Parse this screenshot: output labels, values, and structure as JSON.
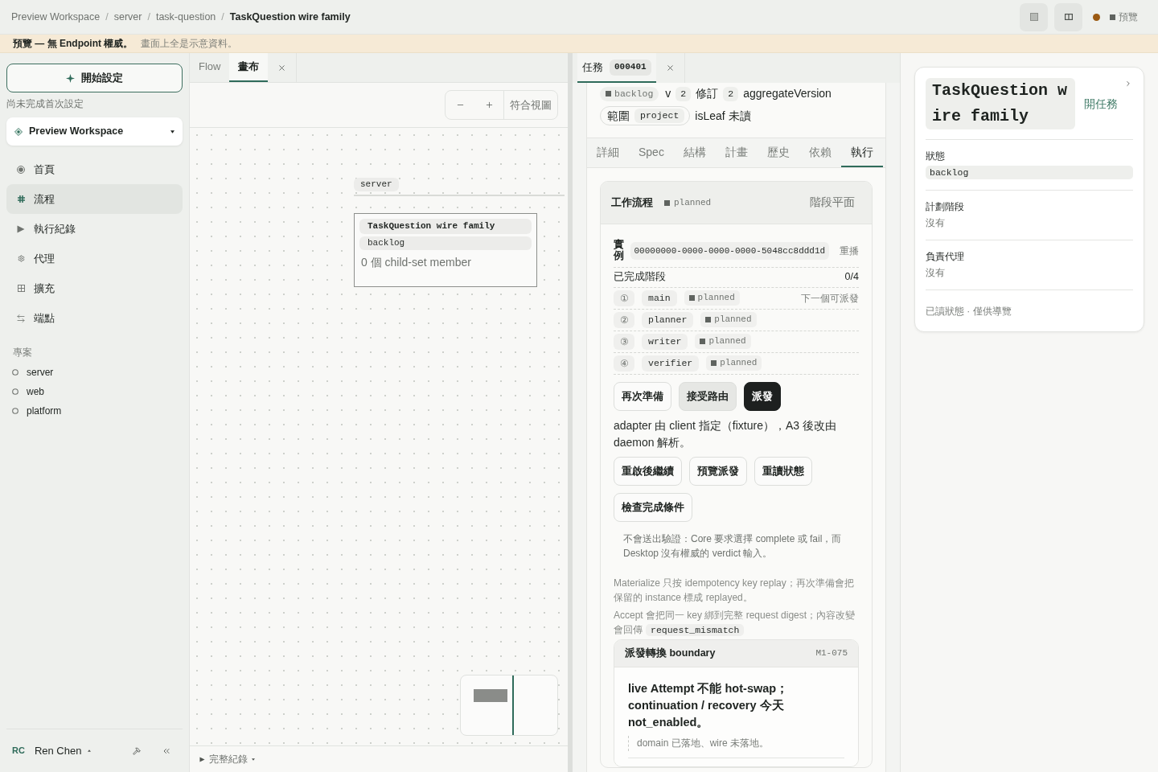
{
  "breadcrumb": {
    "separator": "/",
    "items": [
      {
        "label": "Preview Workspace",
        "current": false
      },
      {
        "label": "server",
        "current": false
      },
      {
        "label": "task-question",
        "current": false
      },
      {
        "label": "TaskQuestion wire family",
        "current": true
      }
    ]
  },
  "topbar": {
    "status": {
      "color": "#9b5a12"
    },
    "mode": "預覽"
  },
  "banner": {
    "title": "預覽 — 無 Endpoint 權威。",
    "text": "畫面上全是示意資料。"
  },
  "sidebar": {
    "setup_button": "開始設定",
    "setup_hint": "尚未完成首次設定",
    "workspace": "Preview Workspace",
    "nav": [
      {
        "label": "首頁",
        "selected": false
      },
      {
        "label": "流程",
        "selected": true
      },
      {
        "label": "執行紀錄",
        "selected": false
      },
      {
        "label": "代理",
        "selected": false
      },
      {
        "label": "擴充",
        "selected": false
      },
      {
        "label": "端點",
        "selected": false
      }
    ],
    "projects": {
      "title": "專案",
      "items": [
        {
          "label": "server"
        },
        {
          "label": "web"
        },
        {
          "label": "platform"
        }
      ]
    },
    "user": {
      "initials": "RC",
      "name": "Ren Chen"
    }
  },
  "canvas_panel": {
    "tabs": [
      {
        "label": "Flow",
        "selected": false
      },
      {
        "label": "畫布",
        "selected": true
      }
    ],
    "fit_button": "符合視圖",
    "group": {
      "label": "server"
    },
    "node": {
      "title": "TaskQuestion wire family",
      "status": "backlog",
      "members": "0 個 child-set member"
    },
    "footer": {
      "label": "完整紀錄"
    }
  },
  "task_panel": {
    "tab": {
      "label": "任務",
      "id": "000401",
      "selected": true
    },
    "chips": {
      "status": "backlog",
      "version": {
        "label": "v",
        "value": "2"
      },
      "revision": {
        "label": "修訂",
        "value": "2"
      },
      "aggregate": "aggregateVersion",
      "scope": {
        "label": "範圍",
        "value": "project"
      },
      "leaf": "isLeaf 未讀"
    },
    "tabs": [
      {
        "label": "詳細",
        "selected": false
      },
      {
        "label": "Spec",
        "selected": false
      },
      {
        "label": "結構",
        "selected": false
      },
      {
        "label": "計畫",
        "selected": false
      },
      {
        "label": "歷史",
        "selected": false
      },
      {
        "label": "依賴",
        "selected": false
      },
      {
        "label": "執行",
        "selected": true
      }
    ],
    "workflow": {
      "title": "工作流程",
      "status": "planned",
      "view": "階段平面",
      "instance": {
        "label": "實例",
        "id": "00000000-0000-0000-0000-5048cc8ddd1d",
        "action": "重播"
      },
      "completed": {
        "label": "已完成階段",
        "value": "0/4"
      },
      "stages": [
        {
          "index": "①",
          "name": "main",
          "status": "planned",
          "note": "下一個可派發"
        },
        {
          "index": "②",
          "name": "planner",
          "status": "planned"
        },
        {
          "index": "③",
          "name": "writer",
          "status": "planned"
        },
        {
          "index": "④",
          "name": "verifier",
          "status": "planned"
        }
      ],
      "actions": [
        {
          "label": "再次準備",
          "kind": "outline"
        },
        {
          "label": "接受路由",
          "kind": "secondary"
        },
        {
          "label": "派發",
          "kind": "primary"
        }
      ],
      "adapter_note": "adapter 由 client 指定（fixture），A3 後改由 daemon 解析。",
      "more_actions": [
        {
          "label": "重啟後繼續",
          "kind": "outline"
        },
        {
          "label": "預覽派發",
          "kind": "outline"
        },
        {
          "label": "重讀狀態",
          "kind": "outline"
        },
        {
          "label": "檢查完成條件",
          "kind": "outline"
        }
      ],
      "warning": "不會送出驗證：Core 要求選擇 complete 或 fail，而 Desktop 沒有權威的 verdict 輸入。",
      "notes": [
        {
          "text": "Materialize 只按 idempotency key replay；再次準備會把保留的 instance 標成 replayed。"
        },
        {
          "text": "Accept 會把同一 key 綁到完整 request digest；內容改變會回傳",
          "code": "request_mismatch"
        }
      ],
      "boundary": {
        "title": "派發轉換 boundary",
        "code": "M1-075",
        "statement": "live Attempt 不能 hot-swap；continuation / recovery 今天 not_enabled。",
        "quote": "domain 已落地、wire 未落地。"
      }
    }
  },
  "inspector": {
    "title": "TaskQuestion wire family",
    "open_link": "開任務",
    "fields": [
      {
        "label": "狀態",
        "value": "backlog",
        "kind": "code"
      },
      {
        "label": "計劃階段",
        "value": "沒有",
        "kind": "text"
      },
      {
        "label": "負責代理",
        "value": "沒有",
        "kind": "text"
      }
    ],
    "footer": "已讀狀態 · 僅供導覽"
  }
}
